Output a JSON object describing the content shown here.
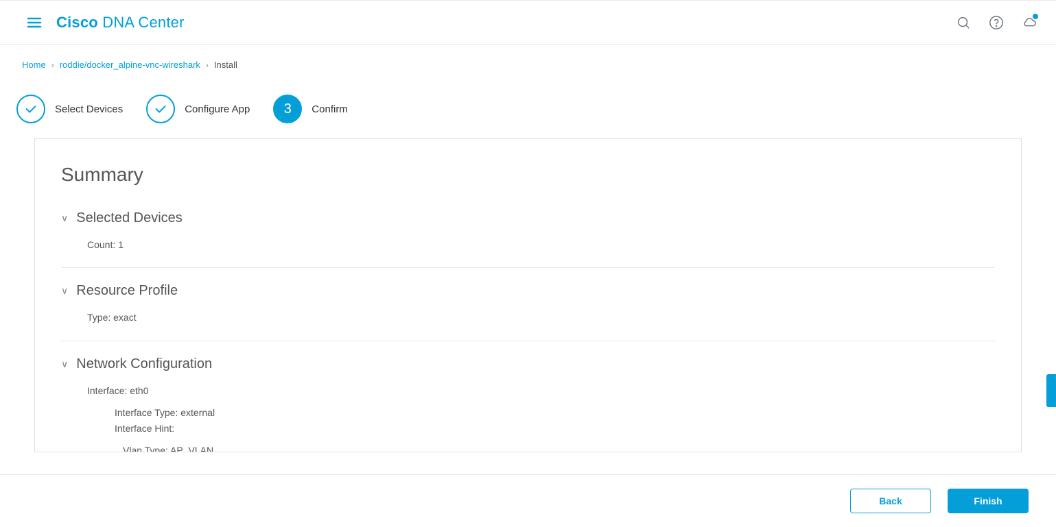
{
  "header": {
    "brand_bold": "Cisco",
    "brand_rest": " DNA Center"
  },
  "breadcrumbs": {
    "home": "Home",
    "mid": "roddie/docker_alpine-vnc-wireshark",
    "current": "Install"
  },
  "steps": {
    "one": "Select Devices",
    "two": "Configure App",
    "three_num": "3",
    "three": "Confirm"
  },
  "summary": {
    "title": "Summary",
    "selected_devices": {
      "heading": "Selected Devices",
      "count": "Count: 1"
    },
    "resource_profile": {
      "heading": "Resource Profile",
      "type": "Type: exact"
    },
    "network_config": {
      "heading": "Network Configuration",
      "interface": "Interface: eth0",
      "interface_type": "Interface Type: external",
      "interface_hint": "Interface Hint:",
      "vlan_type": "Vlan Type: AP_VLAN"
    }
  },
  "footer": {
    "back": "Back",
    "finish": "Finish"
  }
}
